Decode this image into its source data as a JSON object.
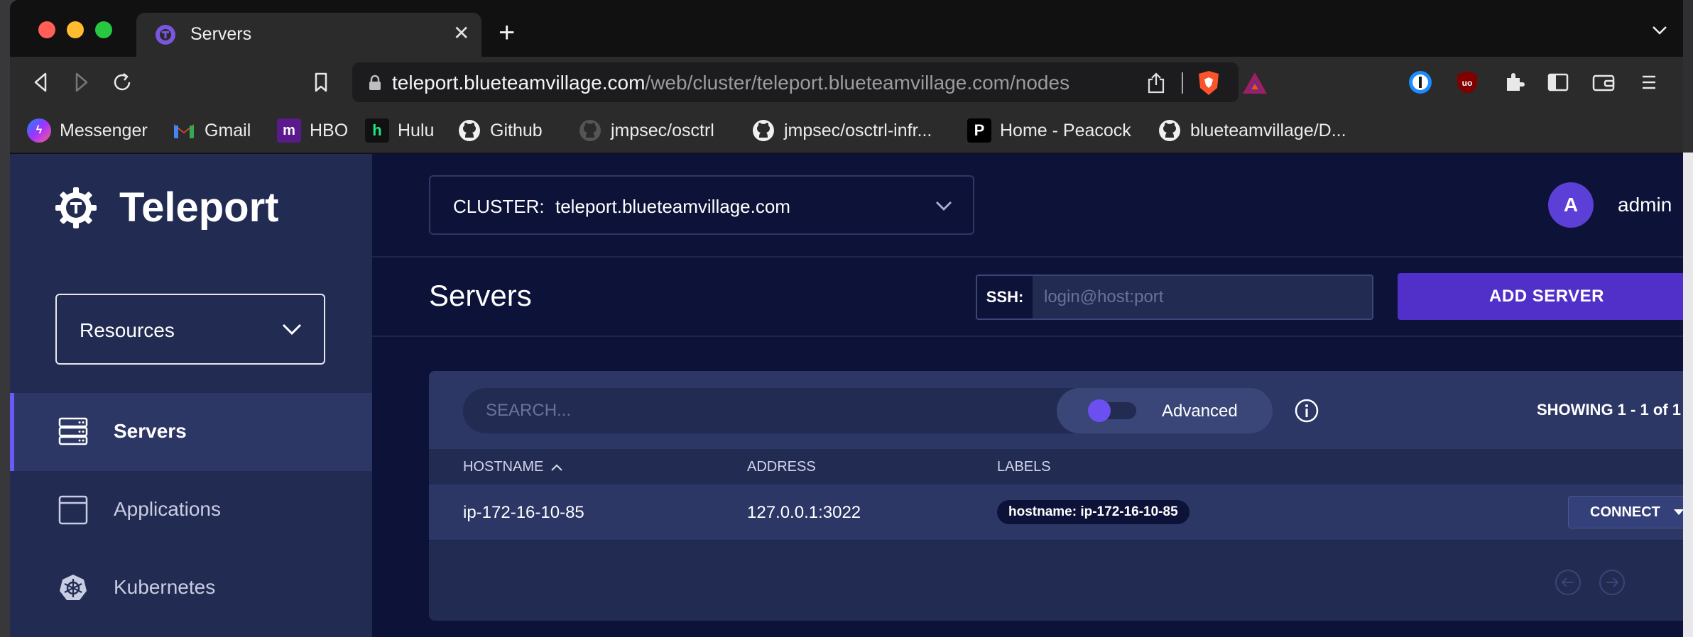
{
  "browser": {
    "tab_title": "Servers",
    "url_host": "teleport.blueteamvillage.com",
    "url_path": "/web/cluster/teleport.blueteamvillage.com/nodes"
  },
  "bookmarks": [
    {
      "label": "Messenger",
      "icon": "messenger-icon"
    },
    {
      "label": "Gmail",
      "icon": "gmail-icon"
    },
    {
      "label": "HBO",
      "icon": "hbo-icon"
    },
    {
      "label": "Hulu",
      "icon": "hulu-icon"
    },
    {
      "label": "Github",
      "icon": "github-icon"
    },
    {
      "label": "jmpsec/osctrl",
      "icon": "github-icon"
    },
    {
      "label": "jmpsec/osctrl-infr...",
      "icon": "github-icon"
    },
    {
      "label": "Home - Peacock",
      "icon": "peacock-icon"
    },
    {
      "label": "blueteamvillage/D...",
      "icon": "github-icon"
    }
  ],
  "sidebar": {
    "logo_text": "Teleport",
    "resources_label": "Resources",
    "items": [
      {
        "label": "Servers",
        "icon": "server-icon",
        "active": true
      },
      {
        "label": "Applications",
        "icon": "application-icon",
        "active": false
      },
      {
        "label": "Kubernetes",
        "icon": "kubernetes-icon",
        "active": false
      }
    ]
  },
  "header": {
    "cluster_label": "CLUSTER:",
    "cluster_value": "teleport.blueteamvillage.com",
    "avatar_letter": "A",
    "username": "admin"
  },
  "main": {
    "title": "Servers",
    "ssh_label": "SSH:",
    "ssh_placeholder": "login@host:port",
    "add_button": "ADD SERVER",
    "search_placeholder": "SEARCH...",
    "advanced_label": "Advanced",
    "showing_prefix": "SHOWING ",
    "showing_range": "1 - 1",
    "showing_suffix": " of 1"
  },
  "table": {
    "columns": [
      "HOSTNAME",
      "ADDRESS",
      "LABELS"
    ],
    "rows": [
      {
        "hostname": "ip-172-16-10-85",
        "address": "127.0.0.1:3022",
        "label": "hostname: ip-172-16-10-85",
        "action": "CONNECT"
      }
    ]
  },
  "colors": {
    "sidebar_bg": "#222b52",
    "page_bg": "#0d1338",
    "accent": "#512fc9",
    "toggle": "#6b4ff0"
  }
}
